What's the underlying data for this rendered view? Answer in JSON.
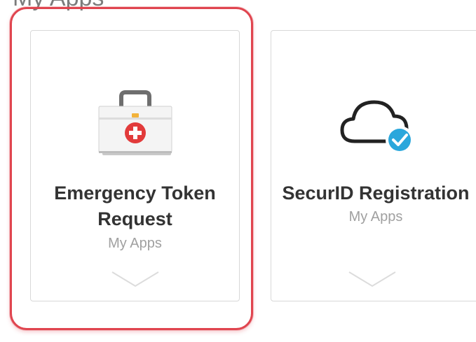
{
  "section": {
    "title": "My Apps"
  },
  "apps": [
    {
      "title_line1": "Emergency Token",
      "title_line2": "Request",
      "subtitle": "My Apps",
      "icon": "first-aid-kit-icon",
      "selected": true
    },
    {
      "title_line1": "SecurID Registration",
      "subtitle": "My Apps",
      "icon": "cloud-check-icon",
      "selected": false
    }
  ],
  "colors": {
    "highlight": "#e0454f",
    "kit_red": "#e23b3b",
    "kit_latch": "#f2b23a",
    "check_blue": "#2aa7dc",
    "title_text": "#333333",
    "subtitle_text": "#a0a0a0"
  }
}
